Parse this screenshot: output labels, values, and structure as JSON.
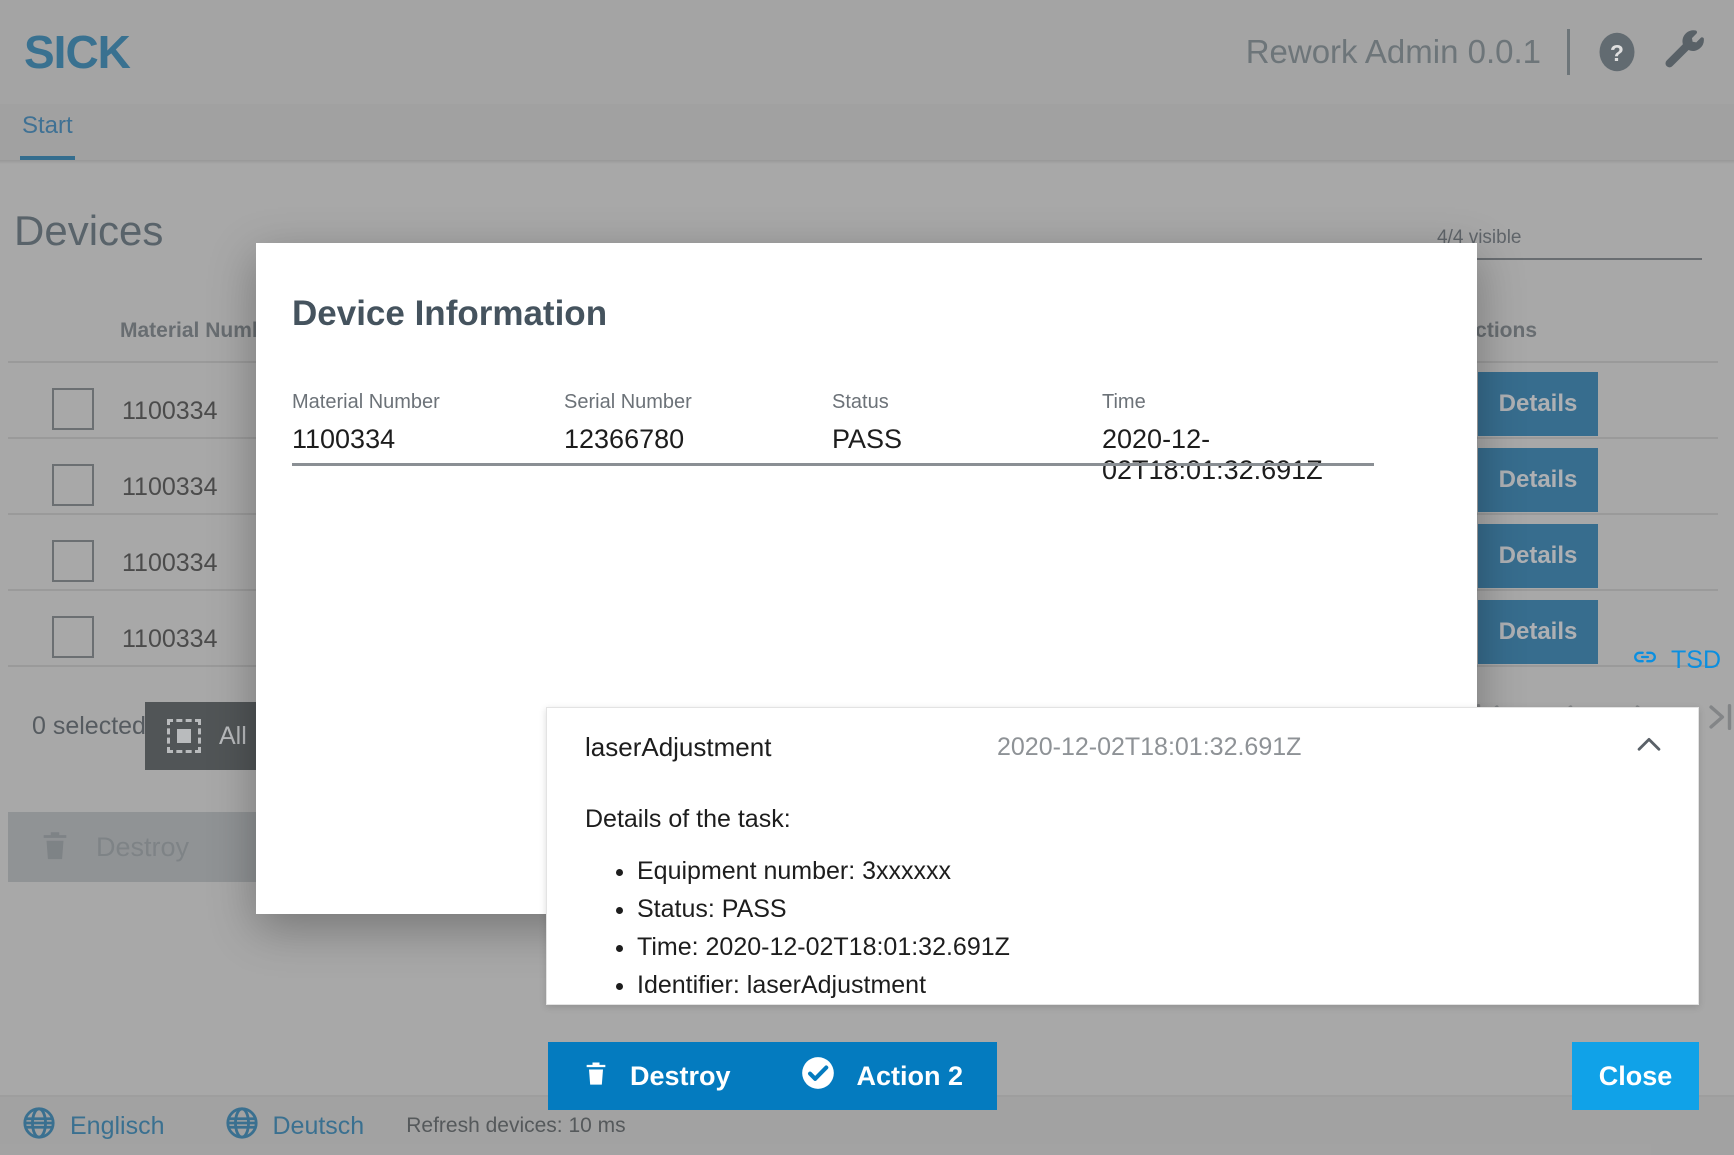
{
  "header": {
    "logo_text": "SICK",
    "app_title": "Rework Admin 0.0.1",
    "help_icon": "help-circle-icon",
    "tools_icon": "wrench-icon"
  },
  "tabs": [
    {
      "label": "Start",
      "active": true
    }
  ],
  "page": {
    "title": "Devices",
    "visible_count": "4/4 visible",
    "table": {
      "columns": [
        "Material Number",
        "Actions"
      ],
      "rows": [
        {
          "material_number": "1100334",
          "action_label": "Details"
        },
        {
          "material_number": "1100334",
          "action_label": "Details"
        },
        {
          "material_number": "1100334",
          "action_label": "Details"
        },
        {
          "material_number": "1100334",
          "action_label": "Details"
        }
      ]
    },
    "selection_text": "0 selected",
    "select_all_label": "All",
    "destroy_label": "Destroy",
    "pagination": {
      "first": "|<",
      "prev": "<",
      "next": ">",
      "last": ">|"
    }
  },
  "footer": {
    "lang_en": "Englisch",
    "lang_de": "Deutsch",
    "refresh_note": "Refresh devices: 10 ms"
  },
  "modal": {
    "title": "Device Information",
    "fields": [
      {
        "label": "Material Number",
        "value": "1100334"
      },
      {
        "label": "Serial Number",
        "value": "12366780"
      },
      {
        "label": "Status",
        "value": "PASS"
      },
      {
        "label": "Time",
        "value": "2020-12-02T18:01:32.691Z"
      }
    ],
    "tsd_link": "TSD",
    "accordion": {
      "name": "laserAdjustment",
      "time": "2020-12-02T18:01:32.691Z",
      "expanded": true,
      "intro": "Details of the task:",
      "items": [
        "Equipment number: 3xxxxxx",
        "Status: PASS",
        "Time: 2020-12-02T18:01:32.691Z",
        "Identifier: laserAdjustment"
      ]
    },
    "buttons": {
      "destroy": "Destroy",
      "action2": "Action 2",
      "close": "Close"
    }
  },
  "colors": {
    "brand_blue": "#12628f",
    "accent_blue": "#047bbf",
    "close_blue": "#10a2e8",
    "link_blue": "#0b8fe0",
    "page_bg": "#b0b0b0"
  }
}
